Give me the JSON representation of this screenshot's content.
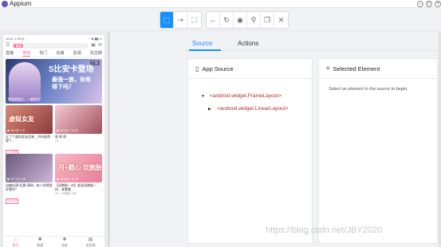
{
  "window": {
    "title": "Appium"
  },
  "toolbar": {
    "group1": [
      {
        "name": "select-elements-icon",
        "glyph": "⬚",
        "active": true
      },
      {
        "name": "swipe-icon",
        "glyph": "⇢",
        "active": false
      },
      {
        "name": "tap-coordinates-icon",
        "glyph": "⛶",
        "active": false
      }
    ],
    "group2": [
      {
        "name": "back-icon",
        "glyph": "←"
      },
      {
        "name": "refresh-icon",
        "glyph": "↻"
      },
      {
        "name": "eye-icon",
        "glyph": "◉"
      },
      {
        "name": "search-icon",
        "glyph": "⚲"
      },
      {
        "name": "copy-xml-icon",
        "glyph": "❐"
      },
      {
        "name": "close-icon",
        "glyph": "✕"
      }
    ]
  },
  "phone": {
    "status_left": "11:01 ⚠ ✉ ◎ ·",
    "status_right": "◈ ▮▮ ▭",
    "search_tag": "番剧",
    "tabs": [
      "直播",
      "推荐",
      "热门",
      "追番",
      "影视",
      "抗击肺"
    ],
    "active_tab": 1,
    "banner": {
      "title": "S比安卡登场",
      "subtitle": "最强一族，你有得下吗？",
      "badge": "广告",
      "caption": "极限超强大，一触即发!"
    },
    "cards": [
      {
        "thumb_text": "虚拟女友",
        "meta": "▶ 26.9万  ◐ 37",
        "title": "买了个虚拟女友回来，不料竟然是个…",
        "tag": "1万点赞",
        "up": "",
        "c1": "#d98c7a",
        "c2": "#8b3a3a"
      },
      {
        "thumb_text": "",
        "meta": "▶ 93.4万  ◐ 0.1万",
        "title": "胖 胖 胖",
        "tag": "",
        "up": "UP ·",
        "c1": "#f4c9d1",
        "c2": "#a0505a"
      },
      {
        "thumb_text": "",
        "meta": "▶ 22.7万  ◐ 16",
        "title": "自编自演“乱舞”演绎，有人觉得很好看吗？",
        "tag": "1万点赞",
        "up": "",
        "c1": "#6a5a7a",
        "c2": "#cfb6d8"
      },
      {
        "thumb_text": "月+戳心 双胞胎",
        "meta": "▶ 80.4万  ◐ 0.1万",
        "title": "【双胞胎一对】谁说双胞胎一样，来看看…",
        "tag": "",
        "up": "UP · 大饭团·小西",
        "c1": "#f7b7c5",
        "c2": "#e77f9a"
      }
    ],
    "bottom_nav": [
      {
        "icon": "⌂",
        "label": "首页"
      },
      {
        "icon": "✱",
        "label": "频道"
      },
      {
        "icon": "✚",
        "label": "动态"
      },
      {
        "icon": "▤",
        "label": "会员购"
      }
    ]
  },
  "inspector": {
    "tabs": [
      "Source",
      "Actions"
    ],
    "active_tab": 0,
    "source_panel": {
      "title": "App Source",
      "nodes": [
        {
          "caret": "▼",
          "label": "<android.widget.FrameLayout>",
          "level": 0
        },
        {
          "caret": "▶",
          "label": "<android.widget.LinearLayout>",
          "level": 1
        }
      ]
    },
    "selected_panel": {
      "title": "Selected Element",
      "hint": "Select an element in the source to begin."
    }
  },
  "watermark": "https://blog.csdn.net/JBY2020"
}
